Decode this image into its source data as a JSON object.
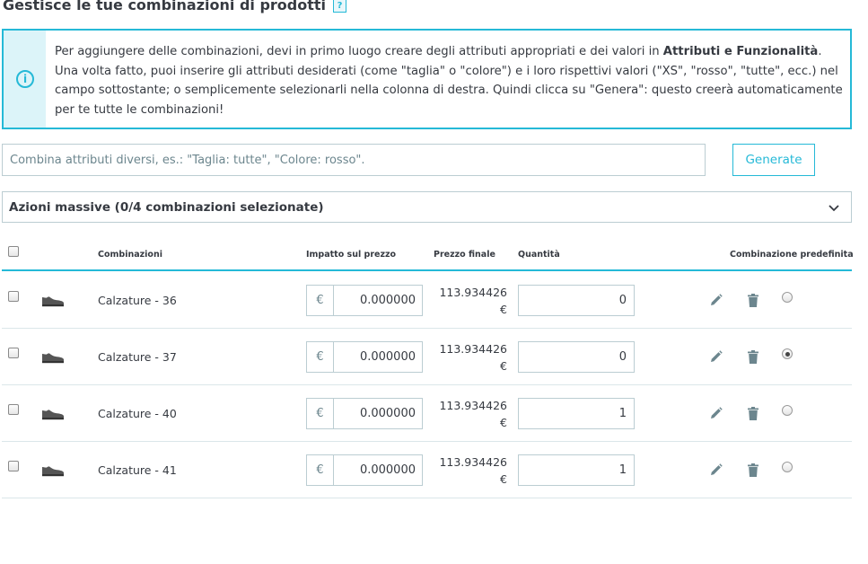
{
  "header": {
    "title": "Gestisce le tue combinazioni di prodotti",
    "help_icon": "?"
  },
  "info": {
    "icon": "i",
    "text_before": "Per aggiungere delle combinazioni, devi in primo luogo creare degli attributi appropriati e dei valori in ",
    "link": "Attributi e Funzionalità",
    "text_after": ". Una volta fatto, puoi inserire gli attributi desiderati (come \"taglia\" o \"colore\") e i loro rispettivi valori (\"XS\", \"rosso\", \"tutte\", ecc.) nel campo sottostante; o semplicemente selezionarli nella colonna di destra. Quindi clicca su \"Genera\": questo creerà automaticamente per te tutte le combinazioni!"
  },
  "combine": {
    "placeholder": "Combina attributi diversi, es.: \"Taglia: tutte\", \"Colore: rosso\".",
    "button": "Generate"
  },
  "bulk": {
    "label": "Azioni massive (0/4 combinazioni selezionate)"
  },
  "table": {
    "headers": {
      "combinations": "Combinazioni",
      "price_impact": "Impatto sul prezzo",
      "final_price": "Prezzo finale",
      "quantity": "Quantità",
      "default": "Combinazione predefinita"
    },
    "rows": [
      {
        "name": "Calzature - 36",
        "currency": "€",
        "impact": "0.000000",
        "final": "113.934426",
        "final_currency": "€",
        "quantity": "0",
        "default": false
      },
      {
        "name": "Calzature - 37",
        "currency": "€",
        "impact": "0.000000",
        "final": "113.934426",
        "final_currency": "€",
        "quantity": "0",
        "default": true
      },
      {
        "name": "Calzature - 40",
        "currency": "€",
        "impact": "0.000000",
        "final": "113.934426",
        "final_currency": "€",
        "quantity": "1",
        "default": false
      },
      {
        "name": "Calzature - 41",
        "currency": "€",
        "impact": "0.000000",
        "final": "113.934426",
        "final_currency": "€",
        "quantity": "1",
        "default": false
      }
    ]
  },
  "colors": {
    "accent": "#25b9d7",
    "text": "#363a41",
    "border": "#bbcdd2",
    "info_bg": "#dcf4f9"
  },
  "icons": {
    "row_image": "shoe-icon",
    "edit": "pencil-icon",
    "delete": "trash-icon",
    "bulk_toggle": "chevron-down-icon"
  }
}
